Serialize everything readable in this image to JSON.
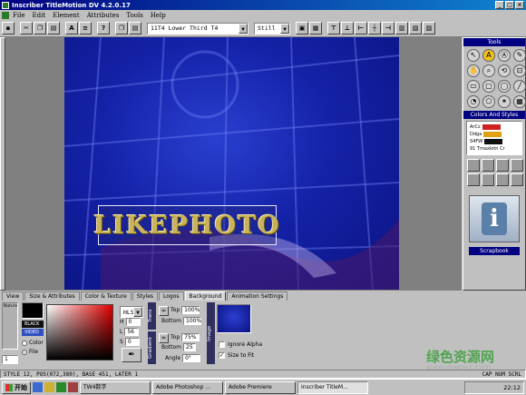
{
  "window": {
    "title": "Inscriber TitleMotion DV 4.2.0.17"
  },
  "menu": [
    "File",
    "Edit",
    "Element",
    "Attributes",
    "Tools",
    "Help"
  ],
  "toolbar": {
    "style_combo": "11T4  Lower Third T4",
    "mode_combo": "Still"
  },
  "canvas": {
    "logo_text": "LIKEPHOTO"
  },
  "palette": {
    "tools_title": "Tools",
    "colors_title": "Colors And Styles",
    "style_names": [
      "ArCs",
      "Ddga",
      "S4FW"
    ],
    "style_caption": "91 Tmaxlotn Cr",
    "scrapbook_label": "Scrapbook"
  },
  "tabs": [
    "View",
    "Size & Attributes",
    "Color & Texture",
    "Styles",
    "Logos",
    "Background",
    "Animation Settings"
  ],
  "active_tab": "Background",
  "bottom": {
    "nature_label": "Nature",
    "swatch_labels": [
      "BLACK",
      "VIDEO"
    ],
    "radio_color": "Color",
    "radio_file": "File",
    "file_selected": true,
    "color_model": "HLS",
    "h_label": "H",
    "h_value": "0",
    "l_label": "L",
    "l_value": "56",
    "s_label": "S",
    "s_value": "0",
    "top1_label": "Top",
    "top1_value": "100%",
    "bottom1_label": "Bottom",
    "bottom1_value": "100%",
    "top2_label": "Top",
    "top2_value": "75%",
    "bottom2_label": "Bottom",
    "bottom2_value": "25",
    "angle_label": "Angle",
    "angle_value": "0°",
    "vlabel_trans": "Trans",
    "vlabel_gradient": "Gradient",
    "vlabel_image": "Image",
    "ignore_alpha": "Ignore Alpha",
    "size_to_fit": "Size to Fit",
    "size_to_fit_checked": true,
    "spin_value": "1"
  },
  "status": {
    "left": "STYLE  12, POS(072,380), BASE  451, LATER 1",
    "right": "CAP NUM SCRL"
  },
  "taskbar": {
    "start": "开始",
    "tasks": [
      "TW4数学",
      "Adobe Photoshop ...",
      "Adobe Premiere",
      "Inscriber TitleM..."
    ],
    "active_task": 3,
    "clock": "22:12"
  },
  "watermark": {
    "line1": "绿色资源网",
    "line2": "www.downcc.com"
  }
}
